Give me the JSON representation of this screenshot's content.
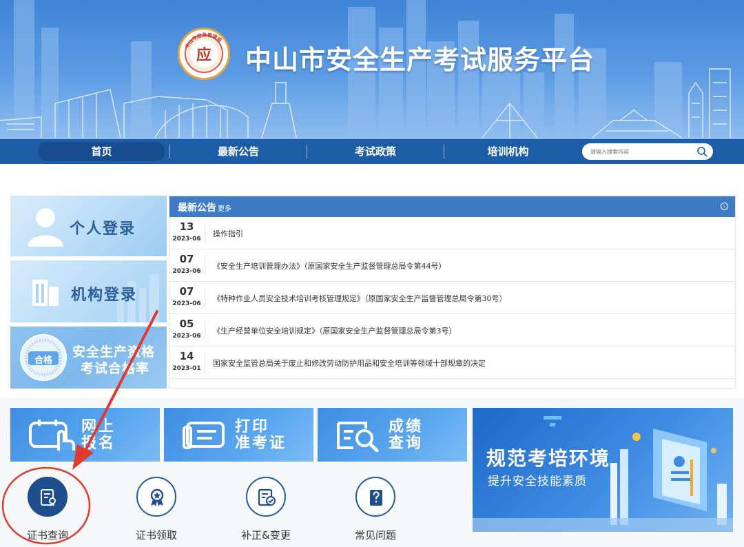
{
  "header": {
    "site_title": "中山市安全生产考试服务平台",
    "logo_mark": "应",
    "logo_ring_text": "中山市应急管理局"
  },
  "nav": {
    "items": [
      {
        "label": "首页",
        "active": true
      },
      {
        "label": "最新公告",
        "active": false
      },
      {
        "label": "考试政策",
        "active": false
      },
      {
        "label": "培训机构",
        "active": false
      }
    ],
    "search_placeholder": "请输入搜索内容"
  },
  "login_cards": [
    {
      "label": "个人登录",
      "icon": "person-icon"
    },
    {
      "label": "机构登录",
      "icon": "building-icon"
    },
    {
      "label_line1": "安全生产资格",
      "label_line2": "考试合格率",
      "badge": "合格",
      "icon": "qualified-seal-icon"
    }
  ],
  "news": {
    "title": "最新公告",
    "more_label": "更多",
    "items": [
      {
        "day": "13",
        "ym": "2023-06",
        "text": "操作指引"
      },
      {
        "day": "07",
        "ym": "2023-06",
        "text": "《安全生产培训管理办法》（原国家安全生产监督管理总局令第44号）"
      },
      {
        "day": "07",
        "ym": "2023-06",
        "text": "《特种作业人员安全技术培训考核管理规定》（原国家安全生产监督管理总局令第30号）"
      },
      {
        "day": "05",
        "ym": "2023-06",
        "text": "《生产经营单位安全培训规定》（原国家安全生产监督管理总局令第3号）"
      },
      {
        "day": "14",
        "ym": "2023-01",
        "text": "国家安全监管总局关于废止和修改劳动防护用品和安全培训等领域十部规章的决定"
      }
    ]
  },
  "tiles": [
    {
      "line1": "网上",
      "line2": "报名",
      "icon": "hand-form-icon"
    },
    {
      "line1": "打印",
      "line2": "准考证",
      "icon": "printer-card-icon"
    },
    {
      "line1": "成绩",
      "line2": "查询",
      "icon": "score-search-icon"
    }
  ],
  "promo": {
    "title": "规范考培环境",
    "subtitle": "提升安全技能素质"
  },
  "services": [
    {
      "label": "证书查询",
      "icon": "certificate-search-icon",
      "highlighted": true
    },
    {
      "label": "证书领取",
      "icon": "award-ribbon-icon",
      "highlighted": false
    },
    {
      "label": "补正&变更",
      "icon": "edit-document-icon",
      "highlighted": false
    },
    {
      "label": "常见问题",
      "icon": "question-doc-icon",
      "highlighted": false
    }
  ],
  "colors": {
    "nav_bg": "#1d5da8",
    "news_header": "#3f7bc6",
    "annotation_red": "#e03a2f",
    "service_active": "#1f4e8c"
  }
}
